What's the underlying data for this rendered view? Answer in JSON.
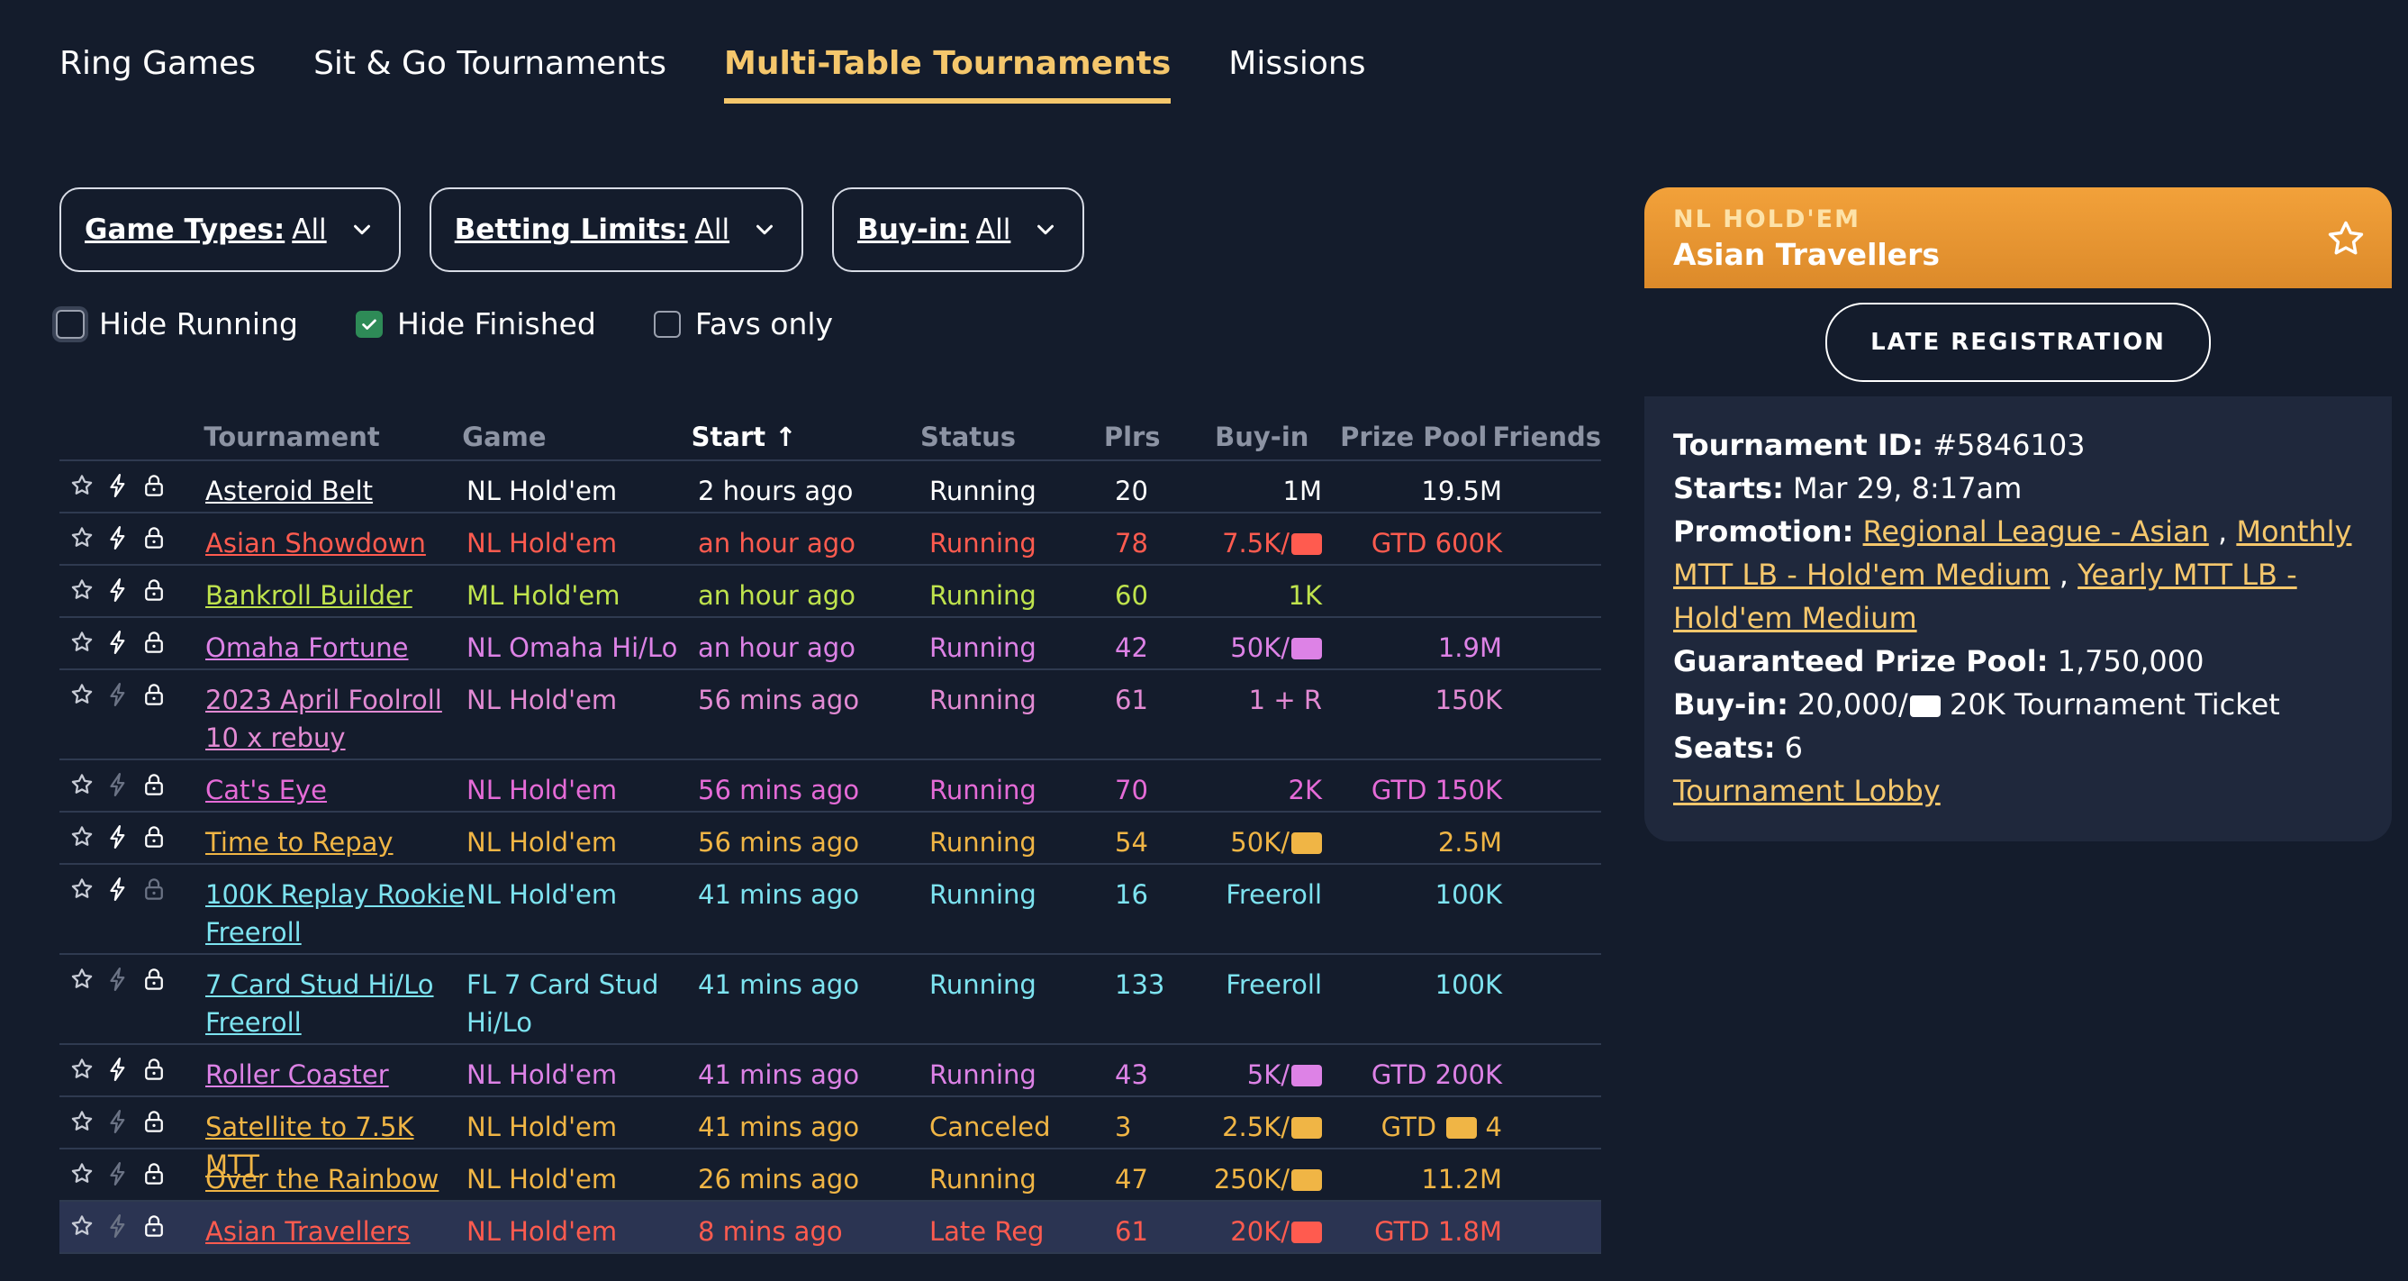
{
  "tabs": [
    {
      "label": "Ring Games"
    },
    {
      "label": "Sit & Go Tournaments"
    },
    {
      "label": "Multi-Table Tournaments"
    },
    {
      "label": "Missions"
    }
  ],
  "filters": {
    "game_types": {
      "label": "Game Types:",
      "value": "All"
    },
    "betting_limits": {
      "label": "Betting Limits:",
      "value": "All"
    },
    "buy_in": {
      "label": "Buy-in:",
      "value": "All"
    }
  },
  "checks": {
    "hide_running": {
      "label": "Hide Running",
      "checked": false
    },
    "hide_finished": {
      "label": "Hide Finished",
      "checked": true
    },
    "favs_only": {
      "label": "Favs only",
      "checked": false
    }
  },
  "columns": {
    "tournament": "Tournament",
    "game": "Game",
    "start": "Start ↑",
    "status": "Status",
    "plrs": "Plrs",
    "buyin": "Buy-in",
    "prize": "Prize Pool",
    "friends": "Friends"
  },
  "rows": [
    {
      "name": "Asteroid Belt",
      "game": "NL Hold'em",
      "start": "2 hours ago",
      "status": "Running",
      "plrs": "20",
      "buyin": "1M",
      "prize": "19.5M",
      "color": "#ffffff",
      "bolt_active": true,
      "lock_active": true
    },
    {
      "name": "Asian Showdown",
      "game": "NL Hold'em",
      "start": "an hour ago",
      "status": "Running",
      "plrs": "78",
      "buyin": "7.5K/",
      "prize": "GTD 600K",
      "color": "#ff5b4f",
      "ticket": "#ff5b4f",
      "bolt_active": true,
      "lock_active": true
    },
    {
      "name": "Bankroll Builder",
      "game": "ML Hold'em",
      "start": "an hour ago",
      "status": "Running",
      "plrs": "60",
      "buyin": "1K",
      "prize": "",
      "color": "#bfe34d",
      "bolt_active": true,
      "lock_active": true
    },
    {
      "name": "Omaha Fortune",
      "game": "NL Omaha Hi/Lo",
      "start": "an hour ago",
      "status": "Running",
      "plrs": "42",
      "buyin": "50K/",
      "prize": "1.9M",
      "color": "#dd82e6",
      "ticket": "#dd82e6",
      "bolt_active": true,
      "lock_active": true
    },
    {
      "name": "2023 April Foolroll 10 x rebuy",
      "game": "NL Hold'em",
      "start": "56 mins ago",
      "status": "Running",
      "plrs": "61",
      "buyin": "1 + R",
      "prize": "150K",
      "color": "#e28ad3",
      "bolt_active": false,
      "lock_active": true
    },
    {
      "name": "Cat's Eye",
      "game": "NL Hold'em",
      "start": "56 mins ago",
      "status": "Running",
      "plrs": "70",
      "buyin": "2K",
      "prize": "GTD 150K",
      "color": "#e56bd7",
      "bolt_active": false,
      "lock_active": true
    },
    {
      "name": "Time to Repay",
      "game": "NL Hold'em",
      "start": "56 mins ago",
      "status": "Running",
      "plrs": "54",
      "buyin": "50K/",
      "prize": "2.5M",
      "color": "#f0b545",
      "ticket": "#f0b545",
      "bolt_active": true,
      "lock_active": true
    },
    {
      "name": "100K Replay Rookie Freeroll",
      "game": "NL Hold'em",
      "start": "41 mins ago",
      "status": "Running",
      "plrs": "16",
      "buyin": "Freeroll",
      "prize": "100K",
      "color": "#7de3f0",
      "bolt_active": true,
      "lock_active": false
    },
    {
      "name": "7 Card Stud Hi/Lo Freeroll",
      "game": "FL 7 Card Stud Hi/Lo",
      "start": "41 mins ago",
      "status": "Running",
      "plrs": "133",
      "buyin": "Freeroll",
      "prize": "100K",
      "color": "#7de3f0",
      "bolt_active": false,
      "lock_active": true
    },
    {
      "name": "Roller Coaster",
      "game": "NL Hold'em",
      "start": "41 mins ago",
      "status": "Running",
      "plrs": "43",
      "buyin": "5K/",
      "prize": "GTD 200K",
      "color": "#dd82e6",
      "ticket": "#dd82e6",
      "bolt_active": true,
      "lock_active": true
    },
    {
      "name": "Satellite to 7.5K MTT",
      "game": "NL Hold'em",
      "start": "41 mins ago",
      "status": "Canceled",
      "plrs": "3",
      "buyin": "2.5K/",
      "prize": "GTD",
      "prize_suffix": "4",
      "prize_ticket": "#f0b545",
      "color": "#f0b545",
      "ticket": "#f0b545",
      "bolt_active": false,
      "lock_active": true
    },
    {
      "name": "Over the Rainbow",
      "game": "NL Hold'em",
      "start": "26 mins ago",
      "status": "Running",
      "plrs": "47",
      "buyin": "250K/",
      "prize": "11.2M",
      "color": "#f0b545",
      "ticket": "#f0b545",
      "bolt_active": false,
      "lock_active": true
    },
    {
      "name": "Asian Travellers",
      "game": "NL Hold'em",
      "start": "8 mins ago",
      "status": "Late Reg",
      "plrs": "61",
      "buyin": "20K/",
      "prize": "GTD 1.8M",
      "color": "#ff5b4f",
      "ticket": "#ff5b4f",
      "bolt_active": false,
      "lock_active": true,
      "selected": true
    }
  ],
  "details": {
    "type": "NL HOLD'EM",
    "name": "Asian Travellers",
    "button": "LATE REGISTRATION",
    "id_label": "Tournament ID:",
    "id_value": "#5846103",
    "starts_label": "Starts:",
    "starts_value": "Mar 29, 8:17am",
    "promotion_label": "Promotion:",
    "promotions": [
      "Regional League - Asian",
      "Monthly MTT LB - Hold'em Medium",
      "Yearly MTT LB - Hold'em Medium"
    ],
    "gtd_label": "Guaranteed Prize Pool:",
    "gtd_value": "1,750,000",
    "buyin_label": "Buy-in:",
    "buyin_value": "20,000/",
    "buyin_ticket": "20K Tournament Ticket",
    "seats_label": "Seats:",
    "seats_value": "6",
    "lobby_link": "Tournament Lobby"
  },
  "colors": {
    "accent": "#f5c76c",
    "background": "#141c2c",
    "card": "#1f283c",
    "header_orange": "#e8962f"
  }
}
